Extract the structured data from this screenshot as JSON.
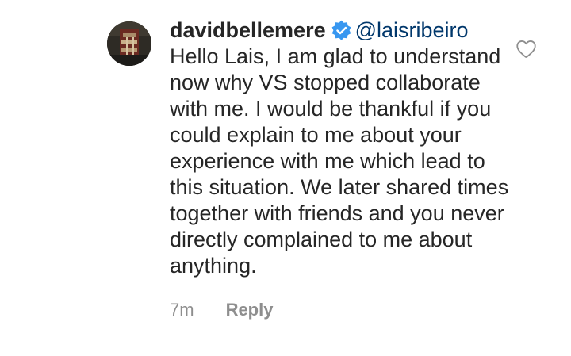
{
  "comment": {
    "username": "davidbellemere",
    "mention": "@laisribeiro",
    "text": "Hello Lais, I am glad to understand now why VS stopped collaborate with me. I would be thankful if you could explain to me about your experience with me which lead to this situation. We later shared times together with friends and you never directly complained to me about anything.",
    "time": "7m",
    "reply_label": "Reply"
  },
  "icons": {
    "verified": "verified-badge-icon",
    "like": "heart-icon"
  },
  "colors": {
    "text": "#262626",
    "mention": "#00376b",
    "secondary": "#8e8e8e",
    "verified": "#3897f0"
  }
}
